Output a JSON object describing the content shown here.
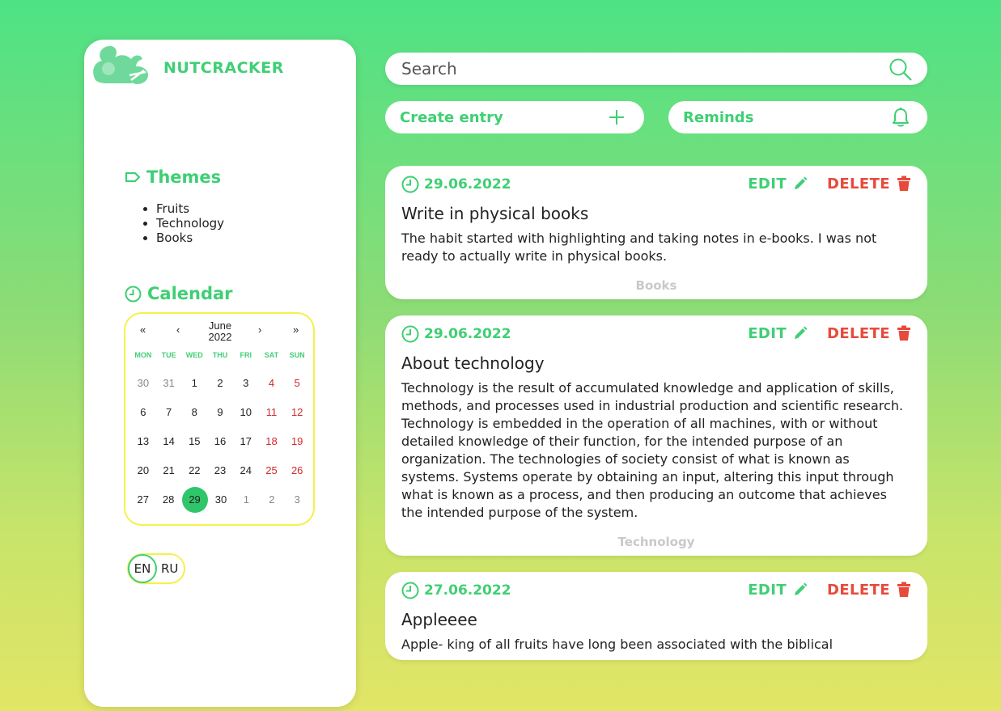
{
  "brand": {
    "name": "NUTCRACKER"
  },
  "sidebar": {
    "themes_title": "Themes",
    "themes": [
      "Fruits",
      "Technology",
      "Books"
    ],
    "calendar_title": "Calendar"
  },
  "calendar": {
    "nav": {
      "prev_year": "«",
      "prev_month": "‹",
      "next_month": "›",
      "next_year": "»"
    },
    "month": "June",
    "year": "2022",
    "weekdays": [
      "MON",
      "TUE",
      "WED",
      "THU",
      "FRI",
      "SAT",
      "SUN"
    ],
    "weeks": [
      [
        "30",
        "31",
        "1",
        "2",
        "3",
        "4",
        "5"
      ],
      [
        "6",
        "7",
        "8",
        "9",
        "10",
        "11",
        "12"
      ],
      [
        "13",
        "14",
        "15",
        "16",
        "17",
        "18",
        "19"
      ],
      [
        "20",
        "21",
        "22",
        "23",
        "24",
        "25",
        "26"
      ],
      [
        "27",
        "28",
        "29",
        "30",
        "1",
        "2",
        "3"
      ]
    ],
    "selected": "29"
  },
  "lang": {
    "en": "EN",
    "ru": "RU",
    "active": "EN"
  },
  "search": {
    "placeholder": "Search"
  },
  "actions": {
    "create": "Create entry",
    "reminds": "Reminds"
  },
  "entry_actions": {
    "edit": "EDIT",
    "delete": "DELETE"
  },
  "entries": [
    {
      "date": "29.06.2022",
      "title": "Write in physical books",
      "text": "The habit started with highlighting and taking notes in e-books. I was not ready to actually write in physical books.",
      "tag": "Books"
    },
    {
      "date": "29.06.2022",
      "title": "About technology",
      "text": "Technology is the result of accumulated knowledge and application of skills, methods, and processes used in industrial production and scientific research. Technology is embedded in the operation of all machines, with or without detailed knowledge of their function, for the intended purpose of an organization. The technologies of society consist of what is known as systems. Systems operate by obtaining an input, altering this input through what is known as a process, and then producing an outcome that achieves the intended purpose of the system.",
      "tag": "Technology"
    },
    {
      "date": "27.06.2022",
      "title": "Appleeee",
      "text": "Apple- king of all fruits have long been associated with the biblical",
      "tag": ""
    }
  ],
  "colors": {
    "accent": "#3fcf74",
    "danger": "#e74a3b",
    "calendar_border": "#f3f24a"
  }
}
